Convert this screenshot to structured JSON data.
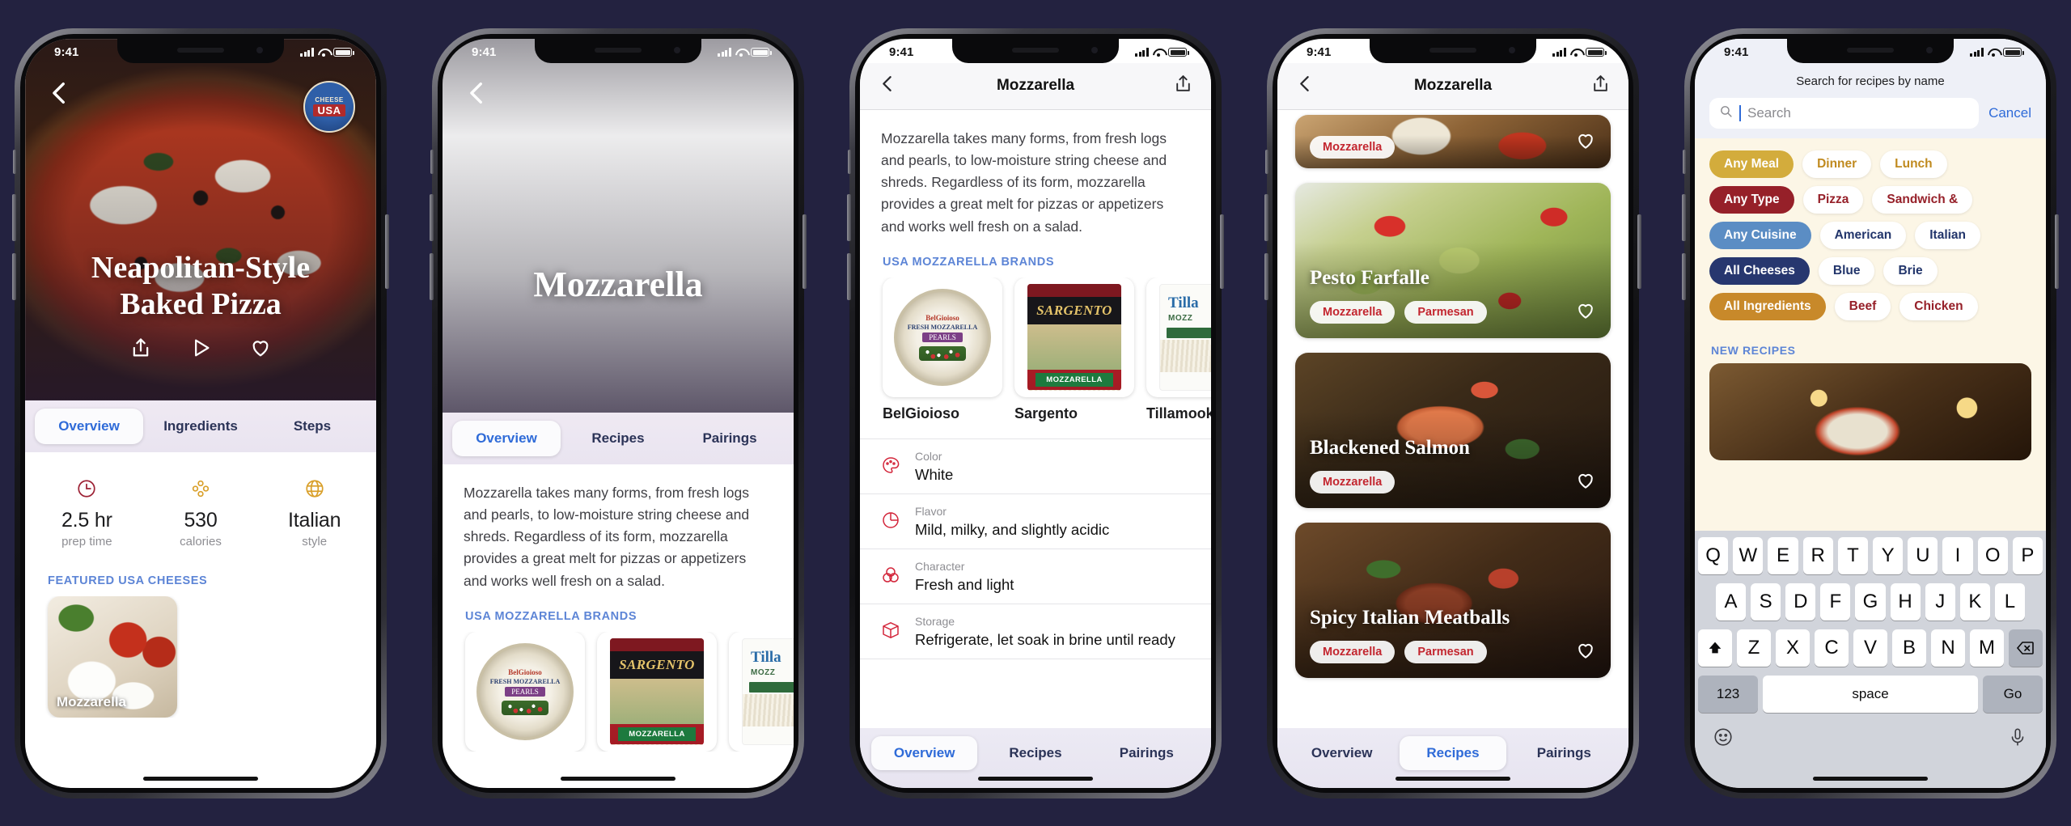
{
  "status_bar": {
    "time": "9:41"
  },
  "screen1": {
    "name": "recipe-detail",
    "back_icon": "chevron-left-icon",
    "badge": {
      "line1": "CHEESE",
      "line2": "USA"
    },
    "hero_title_line1": "Neapolitan-Style",
    "hero_title_line2": "Baked Pizza",
    "actions": [
      "share-icon",
      "play-icon",
      "heart-icon"
    ],
    "tabs": [
      {
        "label": "Overview",
        "active": true
      },
      {
        "label": "Ingredients",
        "active": false
      },
      {
        "label": "Steps",
        "active": false
      }
    ],
    "stats": [
      {
        "icon": "clock-icon",
        "value": "2.5 hr",
        "label": "prep time",
        "color": "#9d2235"
      },
      {
        "icon": "calories-icon",
        "value": "530",
        "label": "calories",
        "color": "#d9a02b"
      },
      {
        "icon": "globe-icon",
        "value": "Italian",
        "label": "style",
        "color": "#d9a02b"
      }
    ],
    "section_header": "FEATURED USA CHEESES",
    "cheeses": [
      {
        "name": "Mozzarella"
      }
    ]
  },
  "screen2": {
    "name": "cheese-detail-hero",
    "back_icon": "chevron-left-icon",
    "hero_title": "Mozzarella",
    "tabs": [
      {
        "label": "Overview",
        "active": true
      },
      {
        "label": "Recipes",
        "active": false
      },
      {
        "label": "Pairings",
        "active": false
      }
    ],
    "paragraph": "Mozzarella takes many forms, from fresh logs and pearls, to low-moisture string cheese and shreds. Regardless of its form, mozzarella provides a great melt for pizzas or appetizers and works well fresh on a salad.",
    "section_header": "USA MOZZARELLA BRANDS",
    "brands": [
      {
        "name": "BelGioioso",
        "pack": "tub",
        "l1": "BelGioioso",
        "l2": "FRESH MOZZARELLA",
        "l3": "PEARLS"
      },
      {
        "name": "Sargento",
        "pack": "bag",
        "logo": "SARGENTO",
        "green": "MOZZARELLA"
      },
      {
        "name": "Tillamook",
        "pack": "sleeve",
        "t": "Tilla",
        "s": "MOZZ"
      }
    ]
  },
  "screen3": {
    "name": "cheese-detail-overview",
    "back_icon": "chevron-left-icon",
    "nav_title": "Mozzarella",
    "share_icon": "share-icon",
    "paragraph": "Mozzarella takes many forms, from fresh logs and pearls, to low-moisture string cheese and shreds. Regardless of its form, mozzarella provides a great melt for pizzas or appetizers and works well fresh on a salad.",
    "section_header": "USA MOZZARELLA BRANDS",
    "brands": [
      {
        "name": "BelGioioso",
        "pack": "tub",
        "l1": "BelGioioso",
        "l2": "FRESH MOZZARELLA",
        "l3": "PEARLS"
      },
      {
        "name": "Sargento",
        "pack": "bag",
        "logo": "SARGENTO",
        "green": "MOZZARELLA"
      },
      {
        "name": "Tillamook",
        "pack": "sleeve",
        "t": "Tilla",
        "s": "MOZZ"
      }
    ],
    "details": [
      {
        "icon": "palette-icon",
        "label": "Color",
        "value": "White"
      },
      {
        "icon": "pie-icon",
        "label": "Flavor",
        "value": "Mild, milky, and slightly acidic"
      },
      {
        "icon": "venn-icon",
        "label": "Character",
        "value": "Fresh and light"
      },
      {
        "icon": "box-icon",
        "label": "Storage",
        "value": "Refrigerate, let soak in brine until ready"
      }
    ],
    "tabs": [
      {
        "label": "Overview",
        "active": true
      },
      {
        "label": "Recipes",
        "active": false
      },
      {
        "label": "Pairings",
        "active": false
      }
    ]
  },
  "screen4": {
    "name": "cheese-recipes-list",
    "back_icon": "chevron-left-icon",
    "nav_title": "Mozzarella",
    "share_icon": "share-icon",
    "recipes": [
      {
        "title": "",
        "tags": [
          "Mozzarella"
        ],
        "bg": "bg-topcard",
        "partial": true
      },
      {
        "title": "Pesto Farfalle",
        "tags": [
          "Mozzarella",
          "Parmesan"
        ],
        "bg": "bg-pesto"
      },
      {
        "title": "Blackened Salmon",
        "tags": [
          "Mozzarella"
        ],
        "bg": "bg-salmon"
      },
      {
        "title": "Spicy Italian Meatballs",
        "tags": [
          "Mozzarella",
          "Parmesan"
        ],
        "bg": "bg-meat"
      }
    ],
    "tabs": [
      {
        "label": "Overview",
        "active": false
      },
      {
        "label": "Recipes",
        "active": true
      },
      {
        "label": "Pairings",
        "active": false
      }
    ]
  },
  "screen5": {
    "name": "recipe-search",
    "search_title": "Search for recipes by name",
    "search_icon": "search-icon",
    "search_value": "",
    "search_placeholder": "Search",
    "cancel_label": "Cancel",
    "filter_rows": [
      {
        "name": "meal",
        "color": "#d3ac3c",
        "text": "#c08a1f",
        "chips": [
          {
            "label": "Any Meal",
            "selected": true
          },
          {
            "label": "Dinner",
            "selected": false
          },
          {
            "label": "Lunch",
            "selected": false
          }
        ]
      },
      {
        "name": "type",
        "color": "#962029",
        "text": "#962029",
        "chips": [
          {
            "label": "Any Type",
            "selected": true
          },
          {
            "label": "Pizza",
            "selected": false
          },
          {
            "label": "Sandwich &",
            "selected": false
          }
        ]
      },
      {
        "name": "cuisine",
        "color": "#5b8dc4",
        "text": "#22356b",
        "chips": [
          {
            "label": "Any Cuisine",
            "selected": true
          },
          {
            "label": "American",
            "selected": false
          },
          {
            "label": "Italian",
            "selected": false
          }
        ]
      },
      {
        "name": "cheese",
        "color": "#27376f",
        "text": "#22356b",
        "chips": [
          {
            "label": "All Cheeses",
            "selected": true
          },
          {
            "label": "Blue",
            "selected": false
          },
          {
            "label": "Brie",
            "selected": false
          }
        ]
      },
      {
        "name": "ingredient",
        "color": "#c8892a",
        "text": "#962029",
        "chips": [
          {
            "label": "All Ingredients",
            "selected": true
          },
          {
            "label": "Beef",
            "selected": false
          },
          {
            "label": "Chicken",
            "selected": false
          }
        ]
      }
    ],
    "new_header": "NEW RECIPES",
    "keyboard": {
      "row1": [
        "Q",
        "W",
        "E",
        "R",
        "T",
        "Y",
        "U",
        "I",
        "O",
        "P"
      ],
      "row2": [
        "A",
        "S",
        "D",
        "F",
        "G",
        "H",
        "J",
        "K",
        "L"
      ],
      "row3": [
        "Z",
        "X",
        "C",
        "V",
        "B",
        "N",
        "M"
      ],
      "shift_icon": "shift-icon",
      "backspace_icon": "backspace-icon",
      "numbers_label": "123",
      "space_label": "space",
      "go_label": "Go",
      "emoji_icon": "emoji-icon",
      "mic_icon": "microphone-icon"
    }
  }
}
